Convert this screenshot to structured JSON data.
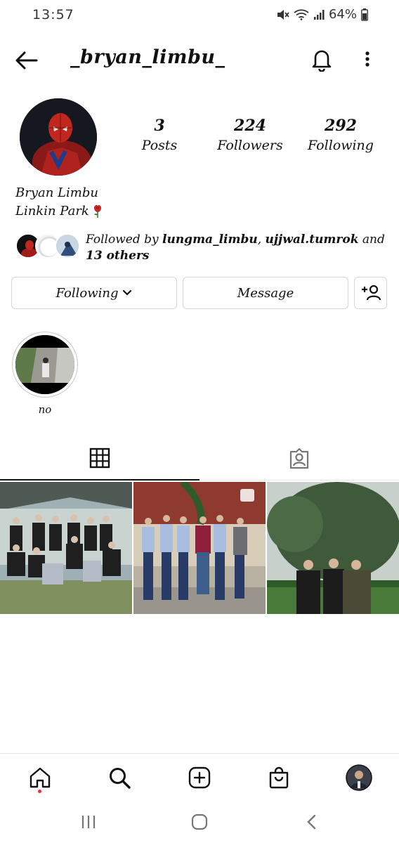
{
  "status_bar": {
    "time": "13:57",
    "battery": "64%"
  },
  "header": {
    "username": "_bryan_limbu_"
  },
  "profile": {
    "stats": [
      {
        "value": "3",
        "label": "Posts"
      },
      {
        "value": "224",
        "label": "Followers"
      },
      {
        "value": "292",
        "label": "Following"
      }
    ],
    "name": "Bryan Limbu",
    "bio": "Linkin Park"
  },
  "followed_by": {
    "prefix": "Followed by ",
    "user1": "lungma_limbu",
    "separator": ", ",
    "user2": "ujjwal.tumrok",
    "connector": " and ",
    "others": "13 others"
  },
  "actions": {
    "following_label": "Following",
    "message_label": "Message"
  },
  "highlights": [
    {
      "label": "no"
    }
  ],
  "tabs": [
    {
      "icon": "grid-icon",
      "active": true
    },
    {
      "icon": "tagged-icon",
      "active": false
    }
  ],
  "bottom_nav": [
    "home-icon",
    "search-icon",
    "add-post-icon",
    "shop-icon",
    "profile-avatar"
  ],
  "colors": {
    "notification_dot": "#e0332f",
    "active_tab": "#111111",
    "border": "#d6d6d6"
  }
}
